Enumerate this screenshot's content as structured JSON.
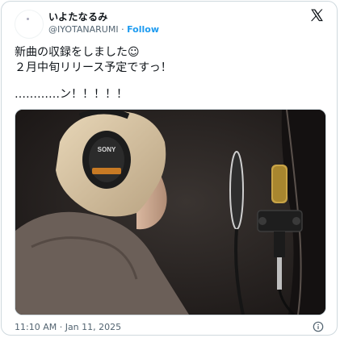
{
  "author": {
    "display_name": "いよたなるみ",
    "handle": "@IYOTANARUMI",
    "separator": "·",
    "follow_label": "Follow"
  },
  "tweet": {
    "line1": "新曲の収録をしました☺",
    "line2": "２月中旬リリース予定ですっ！",
    "line3": "…………ン！！！！！"
  },
  "photo": {
    "headphone_brand": "SONY"
  },
  "footer": {
    "timestamp": "11:10 AM · Jan 11, 2025"
  },
  "icons": {
    "brand": "x-logo-icon",
    "info": "info-icon"
  },
  "colors": {
    "link": "#1d9bf0",
    "text": "#0f1419",
    "muted": "#536471",
    "border": "#cfd9de"
  }
}
